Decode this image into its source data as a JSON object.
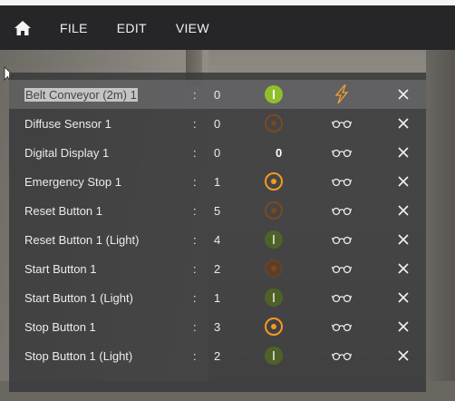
{
  "menu": {
    "home_icon": "home-icon",
    "items": [
      "FILE",
      "EDIT",
      "VIEW"
    ]
  },
  "colors": {
    "active_green": "#8fbf2a",
    "dim_green": "#556b2f",
    "active_orange": "#f59a1e",
    "dim_orange": "#7a4a1e",
    "lightning": "#f0a030"
  },
  "rows": [
    {
      "name": "Belt Conveyor (2m) 1",
      "sep": ":",
      "value": "0",
      "status": "green-active",
      "display": "",
      "probe": "lightning-icon",
      "close": "X",
      "selected": true
    },
    {
      "name": "Diffuse Sensor 1",
      "sep": ":",
      "value": "0",
      "status": "orange-dim",
      "display": "",
      "probe": "glasses-icon",
      "close": "X",
      "selected": false
    },
    {
      "name": "Digital Display 1",
      "sep": ":",
      "value": "0",
      "status": "display",
      "display": "0",
      "probe": "glasses-icon",
      "close": "X",
      "selected": false
    },
    {
      "name": "Emergency Stop 1",
      "sep": ":",
      "value": "1",
      "status": "orange-active",
      "display": "",
      "probe": "glasses-icon",
      "close": "X",
      "selected": false
    },
    {
      "name": "Reset Button 1",
      "sep": ":",
      "value": "5",
      "status": "orange-dim",
      "display": "",
      "probe": "glasses-icon",
      "close": "X",
      "selected": false
    },
    {
      "name": "Reset Button 1 (Light)",
      "sep": ":",
      "value": "4",
      "status": "green-dim",
      "display": "",
      "probe": "glasses-icon",
      "close": "X",
      "selected": false
    },
    {
      "name": "Start Button 1",
      "sep": ":",
      "value": "2",
      "status": "orange-faint",
      "display": "",
      "probe": "glasses-icon",
      "close": "X",
      "selected": false
    },
    {
      "name": "Start Button 1 (Light)",
      "sep": ":",
      "value": "1",
      "status": "green-dim",
      "display": "",
      "probe": "glasses-icon",
      "close": "X",
      "selected": false
    },
    {
      "name": "Stop Button 1",
      "sep": ":",
      "value": "3",
      "status": "orange-active",
      "display": "",
      "probe": "glasses-icon",
      "close": "X",
      "selected": false
    },
    {
      "name": "Stop Button 1 (Light)",
      "sep": ":",
      "value": "2",
      "status": "green-dim",
      "display": "",
      "probe": "glasses-icon",
      "close": "X",
      "selected": false
    }
  ]
}
